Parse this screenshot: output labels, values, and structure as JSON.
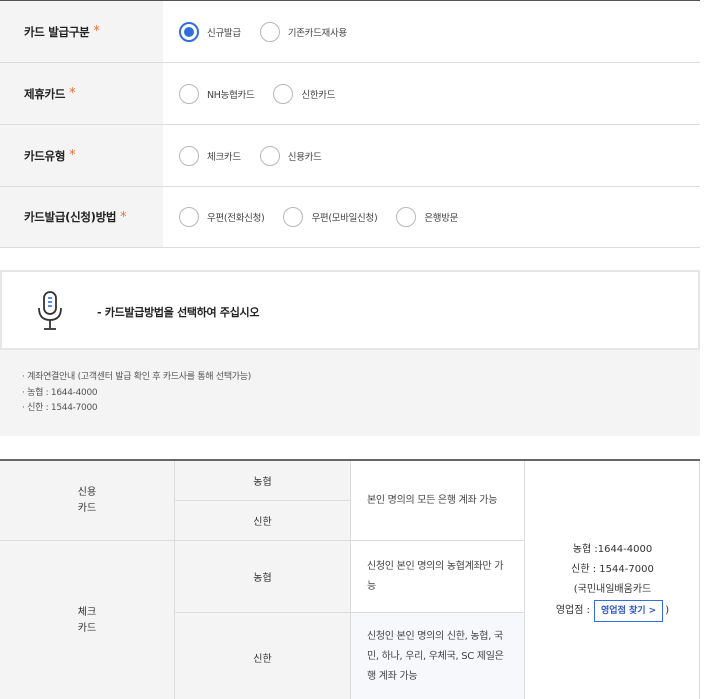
{
  "form": {
    "rows": [
      {
        "label": "카드 발급구분",
        "required": "*",
        "options": [
          "신규발급",
          "기존카드재사용"
        ]
      },
      {
        "label": "제휴카드",
        "required": "*",
        "options": [
          "NH농협카드",
          "신한카드"
        ]
      },
      {
        "label": "카드유형",
        "required": "*",
        "options": [
          "체크카드",
          "신용카드"
        ]
      },
      {
        "label": "카드발급(신청)방법",
        "required": "*",
        "options": [
          "우편(전화신청)",
          "우편(모바일신청)",
          "은행방문"
        ]
      }
    ],
    "selected": "신규발급",
    "accent_color": "#2f6fe0",
    "required_color": "#e8703a"
  },
  "notice": {
    "icon": "microphone-icon",
    "text": "- 카드발급방법을 선택하여 주십시오"
  },
  "info": {
    "items": [
      "· 계좌연결안내 (고객센터 발급 확인 후 카드사를 통해 선택가능)",
      "· 농협 : 1644-4000",
      "· 신한 : 1544-7000"
    ]
  },
  "table": {
    "credit": {
      "type_line1": "신용",
      "type_line2": "카드",
      "bank1": "농협",
      "bank2": "신한",
      "desc": "본인 명의의 모든 은행 계좌 가능"
    },
    "check": {
      "type_line1": "체크",
      "type_line2": "카드",
      "bank1": "농협",
      "desc1_line1": "신청인 본인 명의의 농협계좌만 가",
      "desc1_line2": "능",
      "bank2": "신한",
      "desc2_line1": "신청인 본인 명의의 신한, 농협, 국",
      "desc2_line2": "민, 하나, 우리, 우체국, SC 제일은",
      "desc2_line3": "행 계좌 가능"
    },
    "contact": {
      "line1": "농협 :1644-4000",
      "line2": "신한 : 1544-7000",
      "line3": "(국민내일배움카드",
      "line4_prefix": "영업점 :",
      "find_button": "영업점 찾기 >",
      "line4_suffix": ")"
    }
  }
}
